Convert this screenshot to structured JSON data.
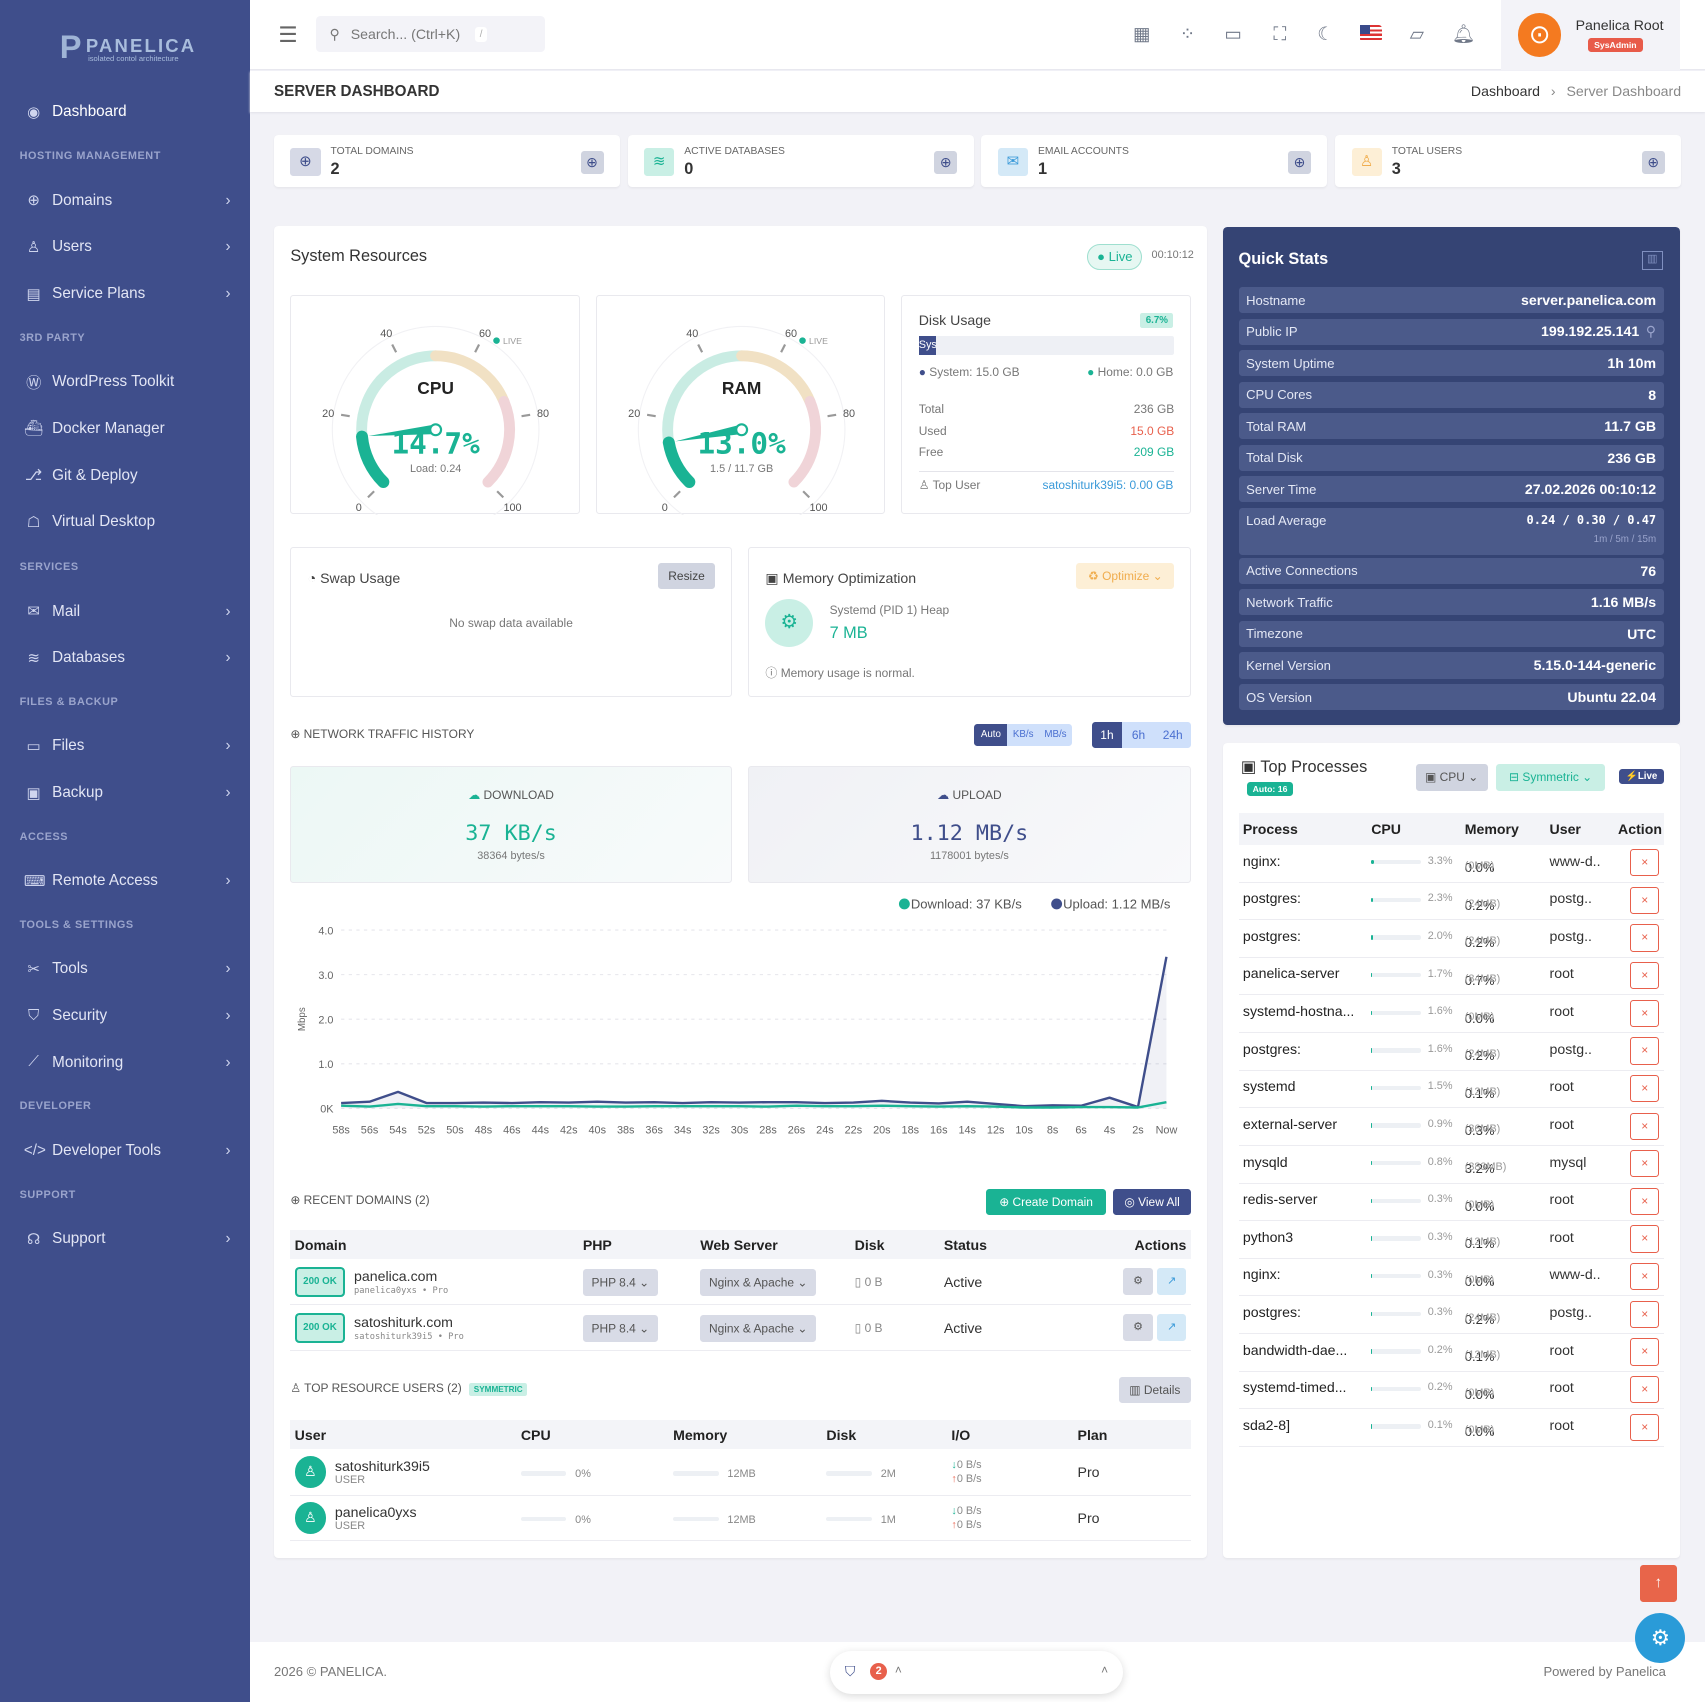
{
  "brand": {
    "name": "PANELICA",
    "tagline": "isolated contol architecture"
  },
  "sidebar": {
    "dashboard": "Dashboard",
    "sections": [
      {
        "title": "HOSTING MANAGEMENT",
        "items": [
          {
            "label": "Domains",
            "icon": "globe-icon"
          },
          {
            "label": "Users",
            "icon": "user-icon"
          },
          {
            "label": "Service Plans",
            "icon": "plans-icon"
          }
        ]
      },
      {
        "title": "3RD PARTY",
        "items": [
          {
            "label": "WordPress Toolkit",
            "icon": "wordpress-icon"
          },
          {
            "label": "Docker Manager",
            "icon": "docker-icon"
          },
          {
            "label": "Git & Deploy",
            "icon": "git-icon"
          },
          {
            "label": "Virtual Desktop",
            "icon": "desktop-icon"
          }
        ]
      },
      {
        "title": "SERVICES",
        "items": [
          {
            "label": "Mail",
            "icon": "mail-icon"
          },
          {
            "label": "Databases",
            "icon": "database-icon"
          }
        ]
      },
      {
        "title": "FILES & BACKUP",
        "items": [
          {
            "label": "Files",
            "icon": "folder-icon"
          },
          {
            "label": "Backup",
            "icon": "save-icon"
          }
        ]
      },
      {
        "title": "ACCESS",
        "items": [
          {
            "label": "Remote Access",
            "icon": "terminal-icon"
          }
        ]
      },
      {
        "title": "TOOLS & SETTINGS",
        "items": [
          {
            "label": "Tools",
            "icon": "tools-icon"
          },
          {
            "label": "Security",
            "icon": "shield-icon"
          },
          {
            "label": "Monitoring",
            "icon": "chart-icon"
          }
        ]
      },
      {
        "title": "DEVELOPER",
        "items": [
          {
            "label": "Developer Tools",
            "icon": "code-icon"
          }
        ]
      },
      {
        "title": "SUPPORT",
        "items": [
          {
            "label": "Support",
            "icon": "headset-icon"
          }
        ]
      }
    ]
  },
  "topbar": {
    "search_placeholder": "Search... (Ctrl+K)",
    "search_shortcut": "/",
    "user_name": "Panelica Root",
    "user_role": "SysAdmin"
  },
  "page": {
    "title": "SERVER DASHBOARD",
    "breadcrumb": [
      "Dashboard",
      "Server Dashboard"
    ]
  },
  "stats": [
    {
      "label": "TOTAL DOMAINS",
      "value": "2",
      "icon": "globe-icon",
      "color": "#3f4e8b",
      "bg": "#d6d9e6"
    },
    {
      "label": "ACTIVE DATABASES",
      "value": "0",
      "icon": "database-icon",
      "color": "#1ab394",
      "bg": "#c9efe5"
    },
    {
      "label": "EMAIL ACCOUNTS",
      "value": "1",
      "icon": "mail-icon",
      "color": "#3a9ad9",
      "bg": "#d4e9f7"
    },
    {
      "label": "TOTAL USERS",
      "value": "3",
      "icon": "user-icon",
      "color": "#f0ad4e",
      "bg": "#fdefd6"
    }
  ],
  "resources": {
    "title": "System Resources",
    "live": "Live",
    "time": "00:10:12",
    "cpu": {
      "label": "CPU",
      "value": 14.7,
      "display": "14.7%",
      "sub": "Load: 0.24",
      "live": "LIVE"
    },
    "ram": {
      "label": "RAM",
      "value": 13.0,
      "display": "13.0%",
      "sub": "1.5 / 11.7 GB",
      "live": "LIVE"
    },
    "gauge_ticks": [
      "0",
      "20",
      "40",
      "60",
      "80",
      "100"
    ],
    "disk": {
      "title": "Disk Usage",
      "percent": "6.7%",
      "fill": 6.7,
      "bar_label": "Sys",
      "legend_system": "System: 15.0 GB",
      "legend_home": "Home: 0.0 GB",
      "total_label": "Total",
      "total": "236 GB",
      "used_label": "Used",
      "used": "15.0 GB",
      "free_label": "Free",
      "free": "209 GB",
      "top_user_label": "Top User",
      "top_user": "satoshiturk39i5: 0.00 GB"
    },
    "swap": {
      "title": "Swap Usage",
      "resize": "Resize",
      "empty": "No swap data available"
    },
    "memopt": {
      "title": "Memory Optimization",
      "optimize": "Optimize",
      "heap_label": "Systemd (PID 1) Heap",
      "heap_value": "7 MB",
      "note": "Memory usage is normal."
    }
  },
  "network": {
    "title": "NETWORK TRAFFIC HISTORY",
    "units": [
      "Auto",
      "KB/s",
      "MB/s"
    ],
    "ranges": [
      "1h",
      "6h",
      "24h"
    ],
    "download": {
      "label": "DOWNLOAD",
      "value": "37 KB/s",
      "bytes": "38364 bytes/s"
    },
    "upload": {
      "label": "UPLOAD",
      "value": "1.12 MB/s",
      "bytes": "1178001 bytes/s"
    }
  },
  "chart_data": {
    "type": "line",
    "ylabel": "Mbps",
    "ylim": [
      0,
      4
    ],
    "yticks": [
      "0K",
      "1.0",
      "2.0",
      "3.0",
      "4.0"
    ],
    "grid": true,
    "legend": "top-right",
    "categories": [
      "58s",
      "56s",
      "54s",
      "52s",
      "50s",
      "48s",
      "46s",
      "44s",
      "42s",
      "40s",
      "38s",
      "36s",
      "34s",
      "32s",
      "30s",
      "28s",
      "26s",
      "24s",
      "22s",
      "20s",
      "18s",
      "16s",
      "14s",
      "12s",
      "10s",
      "8s",
      "6s",
      "4s",
      "2s",
      "Now"
    ],
    "series": [
      {
        "name": "Download: 37 KB/s",
        "color": "#1ab394",
        "values": [
          0.06,
          0.04,
          0.1,
          0.05,
          0.05,
          0.04,
          0.05,
          0.05,
          0.05,
          0.04,
          0.04,
          0.05,
          0.05,
          0.05,
          0.05,
          0.04,
          0.06,
          0.05,
          0.05,
          0.06,
          0.05,
          0.04,
          0.05,
          0.04,
          0.02,
          0.02,
          0.03,
          0.03,
          0.02,
          0.14
        ]
      },
      {
        "name": "Upload: 1.12 MB/s",
        "color": "#3f4e8b",
        "values": [
          0.12,
          0.15,
          0.37,
          0.12,
          0.12,
          0.13,
          0.12,
          0.14,
          0.13,
          0.15,
          0.13,
          0.14,
          0.12,
          0.14,
          0.13,
          0.14,
          0.14,
          0.12,
          0.13,
          0.17,
          0.13,
          0.11,
          0.15,
          0.1,
          0.05,
          0.07,
          0.06,
          0.24,
          0.03,
          3.4
        ]
      }
    ]
  },
  "domains": {
    "title": "RECENT DOMAINS (2)",
    "create": "Create Domain",
    "view_all": "View All",
    "headers": [
      "Domain",
      "PHP",
      "Web Server",
      "Disk",
      "Status",
      "Actions"
    ],
    "rows": [
      {
        "code": "200 OK",
        "name": "panelica.com",
        "meta": "panelica0yxs • Pro",
        "php": "PHP 8.4",
        "server": "Nginx & Apache",
        "disk": "0 B",
        "status": "Active"
      },
      {
        "code": "200 OK",
        "name": "satoshiturk.com",
        "meta": "satoshiturk39i5 • Pro",
        "php": "PHP 8.4",
        "server": "Nginx & Apache",
        "disk": "0 B",
        "status": "Active"
      }
    ]
  },
  "resource_users": {
    "title": "TOP RESOURCE USERS (2)",
    "badge": "SYMMETRIC",
    "details": "Details",
    "headers": [
      "User",
      "CPU",
      "Memory",
      "Disk",
      "I/O",
      "Plan"
    ],
    "rows": [
      {
        "name": "satoshiturk39i5",
        "role": "USER",
        "cpu": "0%",
        "mem": "12MB",
        "disk": "2M",
        "io_down": "0 B/s",
        "io_up": "0 B/s",
        "plan": "Pro"
      },
      {
        "name": "panelica0yxs",
        "role": "USER",
        "cpu": "0%",
        "mem": "12MB",
        "disk": "1M",
        "io_down": "0 B/s",
        "io_up": "0 B/s",
        "plan": "Pro"
      }
    ]
  },
  "quick_stats": {
    "title": "Quick Stats",
    "rows": [
      {
        "label": "Hostname",
        "value": "server.panelica.com"
      },
      {
        "label": "Public IP",
        "value": "199.192.25.141"
      },
      {
        "label": "System Uptime",
        "value": "1h 10m"
      },
      {
        "label": "CPU Cores",
        "value": "8"
      },
      {
        "label": "Total RAM",
        "value": "11.7 GB"
      },
      {
        "label": "Total Disk",
        "value": "236 GB"
      },
      {
        "label": "Server Time",
        "value": "27.02.2026 00:10:12"
      },
      {
        "label": "Load Average",
        "value": "0.24 / 0.30 / 0.47",
        "sub": "1m / 5m / 15m"
      },
      {
        "label": "Active Connections",
        "value": "76"
      },
      {
        "label": "Network Traffic",
        "value": "1.16 MB/s"
      },
      {
        "label": "Timezone",
        "value": "UTC"
      },
      {
        "label": "Kernel Version",
        "value": "5.15.0-144-generic"
      },
      {
        "label": "OS Version",
        "value": "Ubuntu 22.04"
      }
    ]
  },
  "processes": {
    "title": "Top Processes",
    "auto": "Auto: 16",
    "sort": "CPU",
    "mode": "Symmetric",
    "live": "Live",
    "headers": [
      "Process",
      "CPU",
      "Memory",
      "User",
      "Action"
    ],
    "rows": [
      {
        "name": "nginx:",
        "cpu": "3.3%",
        "mem": "0.0%",
        "mb": "(0MB)",
        "user": "www-d.."
      },
      {
        "name": "postgres:",
        "cpu": "2.3%",
        "mem": "0.2%",
        "mb": "(24MB)",
        "user": "postg.."
      },
      {
        "name": "postgres:",
        "cpu": "2.0%",
        "mem": "0.2%",
        "mb": "(24MB)",
        "user": "postg.."
      },
      {
        "name": "panelica-server",
        "cpu": "1.7%",
        "mem": "0.7%",
        "mb": "(84MB)",
        "user": "root"
      },
      {
        "name": "systemd-hostna...",
        "cpu": "1.6%",
        "mem": "0.0%",
        "mb": "(0MB)",
        "user": "root"
      },
      {
        "name": "postgres:",
        "cpu": "1.6%",
        "mem": "0.2%",
        "mb": "(24MB)",
        "user": "postg.."
      },
      {
        "name": "systemd",
        "cpu": "1.5%",
        "mem": "0.1%",
        "mb": "(12MB)",
        "user": "root"
      },
      {
        "name": "external-server",
        "cpu": "0.9%",
        "mem": "0.3%",
        "mb": "(36MB)",
        "user": "root"
      },
      {
        "name": "mysqld",
        "cpu": "0.8%",
        "mem": "3.2%",
        "mb": "(383MB)",
        "user": "mysql"
      },
      {
        "name": "redis-server",
        "cpu": "0.3%",
        "mem": "0.0%",
        "mb": "(0MB)",
        "user": "root"
      },
      {
        "name": "python3",
        "cpu": "0.3%",
        "mem": "0.1%",
        "mb": "(12MB)",
        "user": "root"
      },
      {
        "name": "nginx:",
        "cpu": "0.3%",
        "mem": "0.0%",
        "mb": "(0MB)",
        "user": "www-d.."
      },
      {
        "name": "postgres:",
        "cpu": "0.3%",
        "mem": "0.2%",
        "mb": "(24MB)",
        "user": "postg.."
      },
      {
        "name": "bandwidth-dae...",
        "cpu": "0.2%",
        "mem": "0.1%",
        "mb": "(12MB)",
        "user": "root"
      },
      {
        "name": "systemd-timed...",
        "cpu": "0.2%",
        "mem": "0.0%",
        "mb": "(0MB)",
        "user": "root"
      },
      {
        "name": "sda2-8]",
        "cpu": "0.1%",
        "mem": "0.0%",
        "mb": "(0MB)",
        "user": "root"
      }
    ]
  },
  "footer": {
    "copyright": "2026 © PANELICA.",
    "powered": "Powered by Panelica",
    "alerts": "2"
  }
}
